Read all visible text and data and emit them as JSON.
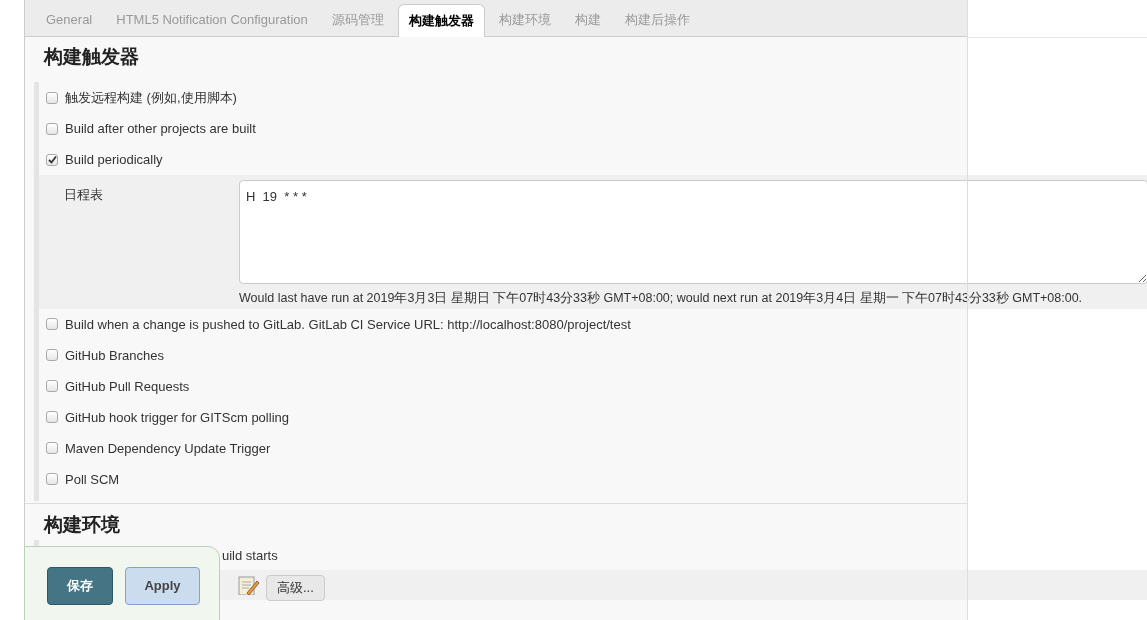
{
  "tabs": [
    {
      "label": "General",
      "selected": false
    },
    {
      "label": "HTML5 Notification Configuration",
      "selected": false
    },
    {
      "label": "源码管理",
      "selected": false
    },
    {
      "label": "构建触发器",
      "selected": true
    },
    {
      "label": "构建环境",
      "selected": false
    },
    {
      "label": "构建",
      "selected": false
    },
    {
      "label": "构建后操作",
      "selected": false
    }
  ],
  "triggers_section": {
    "title": "构建触发器",
    "options": [
      {
        "label": "触发远程构建 (例如,使用脚本)",
        "checked": false
      },
      {
        "label": "Build after other projects are built",
        "checked": false
      },
      {
        "label": "Build periodically",
        "checked": true,
        "schedule": {
          "label": "日程表",
          "value": "H  19  * * *",
          "hint": "Would last have run at 2019年3月3日 星期日 下午07时43分33秒 GMT+08:00; would next run at 2019年3月4日 星期一 下午07时43分33秒 GMT+08:00."
        }
      },
      {
        "label": "Build when a change is pushed to GitLab. GitLab CI Service URL: http://localhost:8080/project/test",
        "checked": false
      },
      {
        "label": "GitHub Branches",
        "checked": false
      },
      {
        "label": "GitHub Pull Requests",
        "checked": false
      },
      {
        "label": "GitHub hook trigger for GITScm polling",
        "checked": false
      },
      {
        "label": "Maven Dependency Update Trigger",
        "checked": false
      },
      {
        "label": "Poll SCM",
        "checked": false
      }
    ]
  },
  "environment_section": {
    "title": "构建环境",
    "option_text": "uild starts",
    "advanced_button": "高级..."
  },
  "save_bar": {
    "save": "保存",
    "apply": "Apply"
  }
}
